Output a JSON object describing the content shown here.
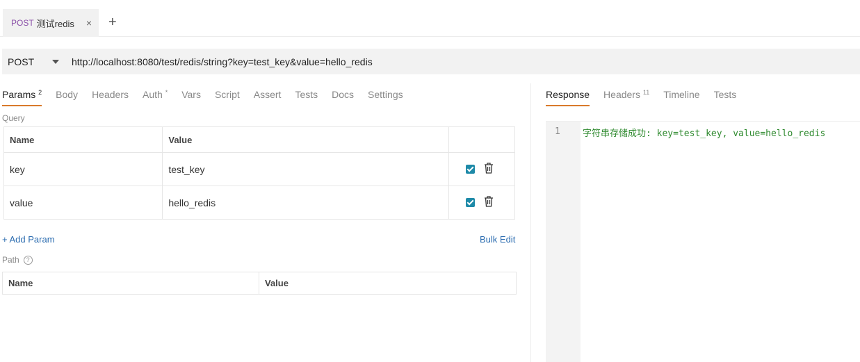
{
  "tab": {
    "method": "POST",
    "name": "测试redis",
    "close": "×",
    "new": "+"
  },
  "request": {
    "method": "POST",
    "url": "http://localhost:8080/test/redis/string?key=test_key&value=hello_redis"
  },
  "left_tabs": [
    {
      "label": "Params",
      "badge": "2"
    },
    {
      "label": "Body"
    },
    {
      "label": "Headers"
    },
    {
      "label": "Auth",
      "badge": "*"
    },
    {
      "label": "Vars"
    },
    {
      "label": "Script"
    },
    {
      "label": "Assert"
    },
    {
      "label": "Tests"
    },
    {
      "label": "Docs"
    },
    {
      "label": "Settings"
    }
  ],
  "query": {
    "label": "Query",
    "headers": {
      "name": "Name",
      "value": "Value"
    },
    "rows": [
      {
        "name": "key",
        "value": "test_key",
        "enabled": true
      },
      {
        "name": "value",
        "value": "hello_redis",
        "enabled": true
      }
    ],
    "add_param": "+ Add Param",
    "bulk_edit": "Bulk Edit"
  },
  "path": {
    "label": "Path",
    "help": "?",
    "headers": {
      "name": "Name",
      "value": "Value"
    }
  },
  "right_tabs": [
    {
      "label": "Response"
    },
    {
      "label": "Headers",
      "badge": "11"
    },
    {
      "label": "Timeline"
    },
    {
      "label": "Tests"
    }
  ],
  "response": {
    "line_number": "1",
    "body": "字符串存储成功: key=test_key, value=hello_redis"
  },
  "colors": {
    "accent": "#d97a2b",
    "method_purple": "#8a4fa8",
    "link_blue": "#2b6cb0",
    "checkbox": "#1e8aa8",
    "code_green": "#2f8a2f"
  }
}
